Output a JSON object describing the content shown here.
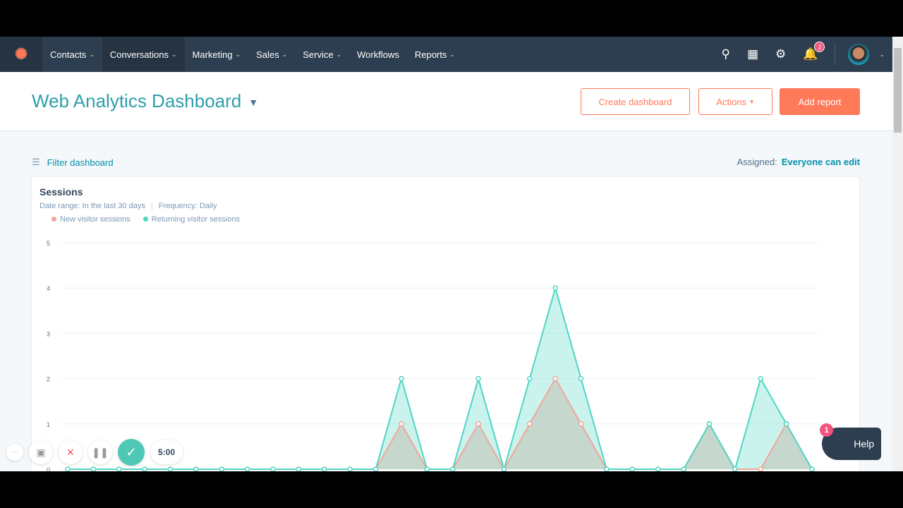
{
  "nav": {
    "items": [
      {
        "label": "Contacts",
        "caret": true
      },
      {
        "label": "Conversations",
        "caret": true
      },
      {
        "label": "Marketing",
        "caret": true
      },
      {
        "label": "Sales",
        "caret": true
      },
      {
        "label": "Service",
        "caret": true
      },
      {
        "label": "Workflows",
        "caret": false
      },
      {
        "label": "Reports",
        "caret": true
      }
    ],
    "notifications": "2"
  },
  "header": {
    "title": "Web Analytics Dashboard",
    "create": "Create dashboard",
    "actions": "Actions",
    "add": "Add report"
  },
  "toolbar": {
    "filter": "Filter dashboard",
    "assigned_label": "Assigned:",
    "assigned_value": "Everyone can edit"
  },
  "card": {
    "title": "Sessions",
    "date_range": "Date range:  In the last 30 days",
    "frequency": "Frequency:  Daily"
  },
  "chart_data": {
    "type": "area",
    "ylim": [
      0,
      5
    ],
    "yticks": [
      "0",
      "1",
      "2",
      "3",
      "4",
      "5"
    ],
    "grid": true,
    "legend": "top-left",
    "series": [
      {
        "name": "New visitor sessions",
        "color": "#f2a69a",
        "values": [
          0,
          0,
          0,
          0,
          0,
          0,
          0,
          0,
          0,
          0,
          0,
          0,
          0,
          1,
          0,
          0,
          1,
          0,
          1,
          2,
          1,
          0,
          0,
          0,
          0,
          1,
          0,
          0,
          1,
          0
        ]
      },
      {
        "name": "Returning visitor sessions",
        "color": "#4fd6c4",
        "values": [
          0,
          0,
          0,
          0,
          0,
          0,
          0,
          0,
          0,
          0,
          0,
          0,
          0,
          2,
          0,
          0,
          2,
          0,
          2,
          4,
          2,
          0,
          0,
          0,
          0,
          1,
          0,
          2,
          1,
          0
        ]
      }
    ]
  },
  "recorder": {
    "timer": "5:00"
  },
  "help": {
    "label": "Help",
    "badge": "1"
  }
}
